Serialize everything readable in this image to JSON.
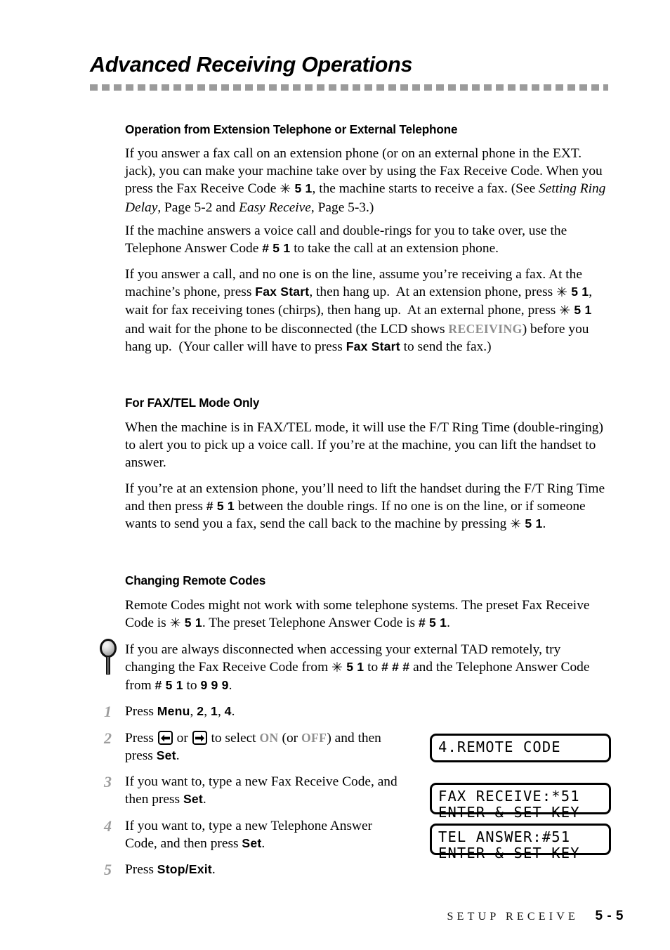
{
  "page": {
    "chapter_title": "Advanced Receiving Operations"
  },
  "sections": [
    {
      "heading": "Operation from Extension Telephone or External Telephone",
      "paragraphs": [
        "If you answer a fax call on an extension phone (or on an external phone in the EXT.  jack), you can make your machine take over by using the Fax Receive Code. When you press the Fax Receive Code ✳ 5 1, the machine starts to receive a fax. (See Setting Ring Delay, Page 5-2 and Easy Receive, Page 5-3.)",
        "If the machine answers a voice call and double-rings for you to take over, use the Telephone Answer Code # 5 1 to take the call at an extension phone.",
        "If you answer a call, and no one is on the line, assume you're receiving a fax. At the machine's phone, press Fax Start, then hang up.  At an extension phone, press ✳ 5 1, wait for fax receiving tones (chirps), then hang up.  At an external phone, press ✳ 5 1 and wait for the phone to be disconnected (the LCD shows RECEIVING) before you hang up.  (Your caller will have to press Fax Start to send the fax.)"
      ]
    },
    {
      "heading": "For FAX/TEL Mode Only",
      "paragraphs": [
        "When the machine is in FAX/TEL mode, it will use the F/T Ring Time (double-ringing) to alert you to pick up a voice call. If you're at the machine, you can lift the handset to answer.",
        "If you're at an extension phone, you'll need to lift the handset during the F/T Ring Time and then press # 5 1 between the double rings. If no one is on the line, or if someone wants to send you a fax, send the call back to the machine by pressing ✳ 5 1."
      ]
    },
    {
      "heading": "Changing Remote Codes",
      "paragraphs": [
        "Remote Codes might not work with some telephone systems. The preset Fax Receive Code is ✳ 5 1. The preset Telephone Answer Code is # 5 1."
      ]
    }
  ],
  "note": {
    "icon": "magnifier-icon",
    "text": "If you are always disconnected when accessing your external TAD remotely, try changing the Fax Receive Code from ✳ 5 1 to # # # and the Telephone Answer Code from # 5 1 to 9 9 9."
  },
  "steps": [
    {
      "num": "1",
      "text": "Press Menu, 2, 1, 4."
    },
    {
      "num": "2",
      "text": "Press ← or → to select ON (or OFF) and then press Set."
    },
    {
      "num": "3",
      "text": "If you want to, type a new Fax Receive Code, and then press Set."
    },
    {
      "num": "4",
      "text": "If you want to, type a new Telephone Answer Code, and then press Set."
    },
    {
      "num": "5",
      "text": "Press Stop/Exit."
    }
  ],
  "inline_labels": {
    "menu_key": "Menu",
    "digit_2": "2",
    "digit_1": "1",
    "digit_4": "4",
    "set_key": "Set",
    "stop_exit_key": "Stop/Exit",
    "fax_start_key": "Fax Start",
    "on_option": "ON",
    "off_option": "OFF",
    "or_word": "or",
    "press_word": "Press",
    "and_then_press": "and then press",
    "to_select": "to select",
    "left_arrow_key": "←",
    "right_arrow_key": "→"
  },
  "lcd_displays": [
    {
      "name": "remote-code-display",
      "line1": "4.REMOTE CODE",
      "line2": ""
    },
    {
      "name": "fax-receive-display",
      "line1": "FAX RECEIVE:*51",
      "line2": "ENTER & SET KEY"
    },
    {
      "name": "tel-answer-display",
      "line1": "TEL ANSWER:#51",
      "line2": "ENTER & SET KEY"
    }
  ],
  "footer": {
    "section": "SETUP RECEIVE",
    "page_number": "5 - 5"
  },
  "colors": {
    "rule_gray": "#9b9b9b",
    "step_number_gray": "#9d9d9d",
    "lcd_word_gray": "#8d8d8d"
  }
}
